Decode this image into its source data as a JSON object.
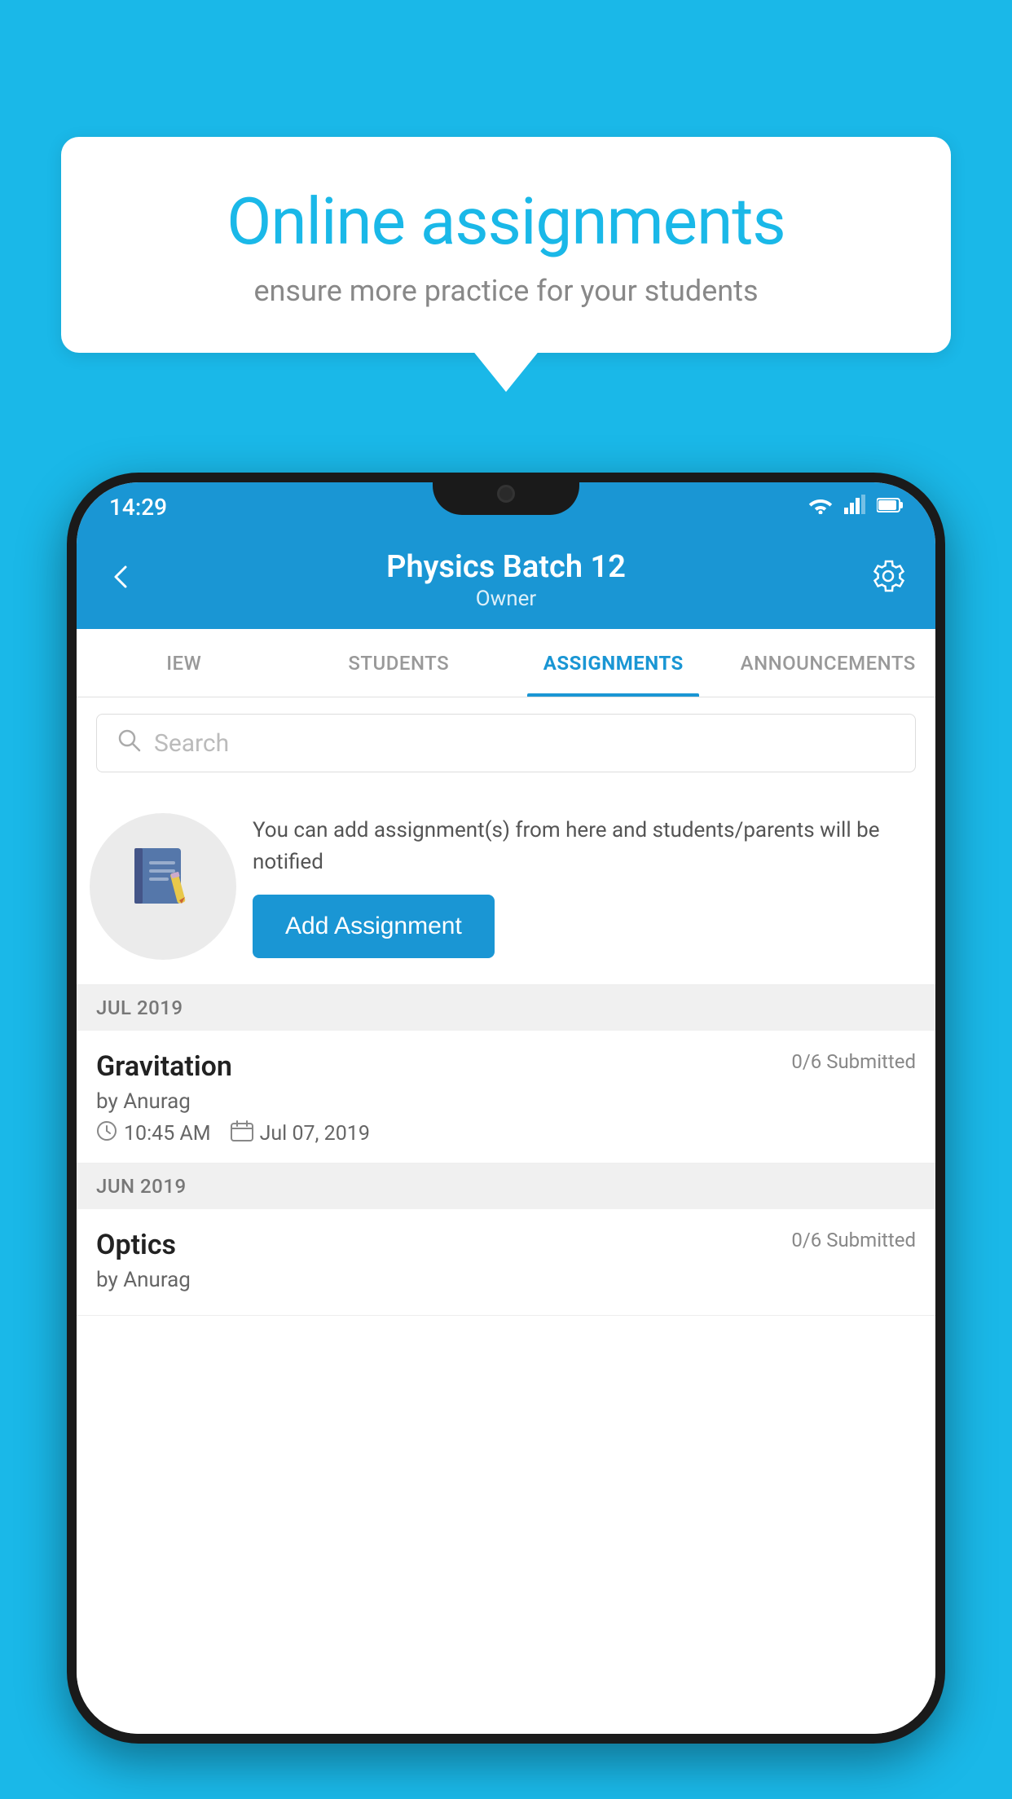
{
  "background_color": "#1ab8e8",
  "speech_bubble": {
    "title": "Online assignments",
    "subtitle": "ensure more practice for your students"
  },
  "status_bar": {
    "time": "14:29",
    "wifi": "▾",
    "signal": "▴",
    "battery": "▮"
  },
  "header": {
    "title": "Physics Batch 12",
    "subtitle": "Owner",
    "back_label": "←",
    "settings_label": "⚙"
  },
  "tabs": [
    {
      "label": "IEW",
      "active": false
    },
    {
      "label": "STUDENTS",
      "active": false
    },
    {
      "label": "ASSIGNMENTS",
      "active": true
    },
    {
      "label": "ANNOUNCEMENTS",
      "active": false
    }
  ],
  "search": {
    "placeholder": "Search"
  },
  "promo": {
    "description": "You can add assignment(s) from here and students/parents will be notified",
    "button_label": "Add Assignment"
  },
  "assignment_groups": [
    {
      "month": "JUL 2019",
      "assignments": [
        {
          "name": "Gravitation",
          "submitted": "0/6 Submitted",
          "by": "by Anurag",
          "time": "10:45 AM",
          "date": "Jul 07, 2019"
        }
      ]
    },
    {
      "month": "JUN 2019",
      "assignments": [
        {
          "name": "Optics",
          "submitted": "0/6 Submitted",
          "by": "by Anurag",
          "time": "",
          "date": ""
        }
      ]
    }
  ]
}
